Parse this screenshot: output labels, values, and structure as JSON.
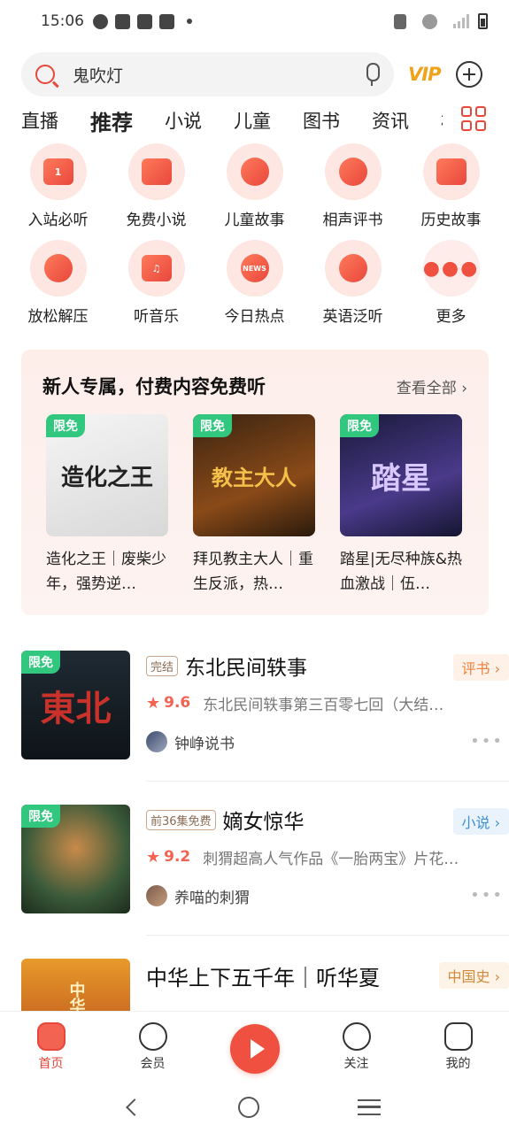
{
  "status_bar": {
    "time": "15:06"
  },
  "search": {
    "value": "鬼吹灯",
    "vip_label": "VIP"
  },
  "tabs": [
    "直播",
    "推荐",
    "小说",
    "儿童",
    "图书",
    "资讯",
    "相"
  ],
  "active_tab": "推荐",
  "categories": [
    {
      "label": "入站必听",
      "icon": "podium-icon"
    },
    {
      "label": "免费小说",
      "icon": "book-icon"
    },
    {
      "label": "儿童故事",
      "icon": "duck-icon"
    },
    {
      "label": "相声评书",
      "icon": "fan-icon"
    },
    {
      "label": "历史故事",
      "icon": "cart-icon"
    },
    {
      "label": "放松解压",
      "icon": "moon-icon"
    },
    {
      "label": "听音乐",
      "icon": "music-note-icon"
    },
    {
      "label": "今日热点",
      "icon": "news-icon"
    },
    {
      "label": "英语泛听",
      "icon": "headset-icon"
    },
    {
      "label": "更多",
      "icon": "more-dots-icon"
    }
  ],
  "promo": {
    "title": "新人专属，付费内容免费听",
    "more": "查看全部",
    "badge": "限免",
    "books": [
      {
        "title": "造化之王｜废柴少年，强势逆…",
        "cover_text": "造化之王"
      },
      {
        "title": "拜见教主大人｜重生反派，热…",
        "cover_text": "教主大人"
      },
      {
        "title": "踏星|无尽种族&热血激战｜伍…",
        "cover_text": "踏星"
      }
    ]
  },
  "list": [
    {
      "badge": "限免",
      "status_tag": "完结",
      "title": "东北民间轶事",
      "genre": "评书",
      "genre_color": "#f07f3c",
      "genre_bg": "#fdf1e8",
      "score": "9.6",
      "desc": "东北民间轶事第三百零七回（大结…",
      "author": "钟峥说书",
      "cover_text": "東北"
    },
    {
      "badge": "限免",
      "status_tag": "前36集免费",
      "title": "嫡女惊华",
      "genre": "小说",
      "genre_color": "#3d8fd6",
      "genre_bg": "#eaf3fc",
      "score": "9.2",
      "desc": "刺猬超高人气作品《一胎两宝》片花…",
      "author": "养喵的刺猬",
      "cover_text": ""
    },
    {
      "title": "中华上下五千年｜听华夏",
      "genre": "中国史",
      "genre_color": "#d08a3a",
      "genre_bg": "#fdf3e6",
      "cover_text": "中华上下"
    }
  ],
  "bottom_nav": [
    {
      "label": "首页",
      "icon": "home-icon"
    },
    {
      "label": "会员",
      "icon": "vip-diamond-icon"
    },
    {
      "label": "",
      "icon": "play-icon"
    },
    {
      "label": "关注",
      "icon": "compass-icon"
    },
    {
      "label": "我的",
      "icon": "star-face-icon"
    }
  ]
}
